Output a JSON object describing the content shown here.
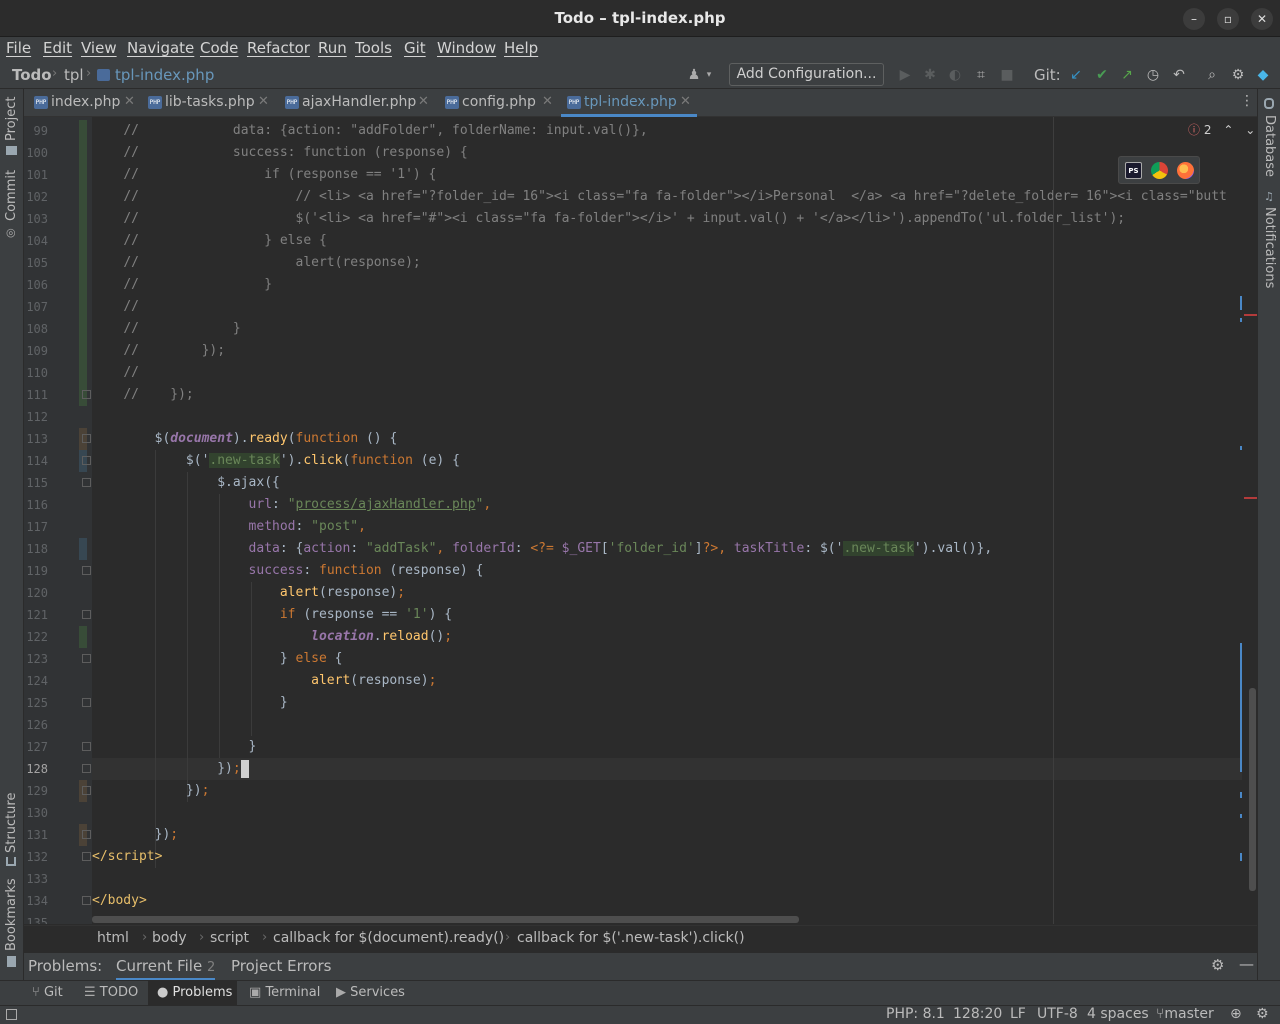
{
  "window": {
    "title": "Todo – tpl-index.php",
    "minimize_glyph": "–",
    "maximize_glyph": "▫",
    "close_glyph": "✕"
  },
  "menu": {
    "items": [
      "File",
      "Edit",
      "View",
      "Navigate",
      "Code",
      "Refactor",
      "Run",
      "Tools",
      "Git",
      "Window",
      "Help"
    ]
  },
  "nav": {
    "project": "Todo",
    "folder": "tpl",
    "file": "tpl-index.php",
    "add_configuration": "Add Configuration...",
    "git_label": "Git:"
  },
  "tabs": [
    {
      "label": "index.php",
      "active": false
    },
    {
      "label": "lib-tasks.php",
      "active": false
    },
    {
      "label": "ajaxHandler.php",
      "active": false
    },
    {
      "label": "config.php",
      "active": false
    },
    {
      "label": "tpl-index.php",
      "active": true
    }
  ],
  "tab_icon_text": "PHP",
  "side_tools": {
    "left_top": [
      "Project",
      "Commit"
    ],
    "left_bottom": [
      "Structure",
      "Bookmarks"
    ],
    "right": [
      "Database",
      "Notifications"
    ]
  },
  "editor": {
    "error_count": "2",
    "current_line": 128,
    "browser_icons": [
      "PS",
      "",
      ""
    ]
  },
  "code_lines": [
    {
      "n": "99"
    },
    {
      "n": "100"
    },
    {
      "n": "101"
    },
    {
      "n": "102"
    },
    {
      "n": "103"
    },
    {
      "n": "104"
    },
    {
      "n": "105"
    },
    {
      "n": "106"
    },
    {
      "n": "107"
    },
    {
      "n": "108"
    },
    {
      "n": "109"
    },
    {
      "n": "110"
    },
    {
      "n": "111"
    },
    {
      "n": "112"
    },
    {
      "n": "113"
    },
    {
      "n": "114"
    },
    {
      "n": "115"
    },
    {
      "n": "116"
    },
    {
      "n": "117"
    },
    {
      "n": "118"
    },
    {
      "n": "119"
    },
    {
      "n": "120"
    },
    {
      "n": "121"
    },
    {
      "n": "122"
    },
    {
      "n": "123"
    },
    {
      "n": "124"
    },
    {
      "n": "125"
    },
    {
      "n": "126"
    },
    {
      "n": "127"
    },
    {
      "n": "128"
    },
    {
      "n": "129"
    },
    {
      "n": "130"
    },
    {
      "n": "131"
    },
    {
      "n": "132"
    },
    {
      "n": "133"
    },
    {
      "n": "134"
    },
    {
      "n": "135"
    }
  ],
  "code": {
    "l99": [
      "//",
      "            data: {action: \"addFolder\", folderName: input.val()},"
    ],
    "l100": [
      "//",
      "            success: function (response) {"
    ],
    "l101": [
      "//",
      "                if (response == '1') {"
    ],
    "l102": [
      "//",
      "                    // <li> <a href=\"?folder_id= 16\"><i class=\"fa fa-folder\"></i>Personal  </a> <a href=\"?delete_folder= 16\"><i class=\"butt"
    ],
    "l103": [
      "//",
      "                    $('<li> <a href=\"#\"><i class=\"fa fa-folder\"></i>' + input.val() + '</a></li>').appendTo('ul.folder_list');"
    ],
    "l104": [
      "//",
      "                } else {"
    ],
    "l105": [
      "//",
      "                    alert(response);"
    ],
    "l106": [
      "//",
      "                }"
    ],
    "l107": [
      "//",
      ""
    ],
    "l108": [
      "//",
      "            }"
    ],
    "l109": [
      "//",
      "        });"
    ],
    "l110": [
      "//",
      ""
    ],
    "l111": [
      "//",
      "    });"
    ],
    "l113": {
      "a": "$(",
      "b": "document",
      "c": ").",
      "d": "ready",
      "e": "(",
      "f": "function",
      "g": " () {"
    },
    "l114": {
      "a": "$('",
      "b": ".new-task",
      "c": "').",
      "d": "click",
      "e": "(",
      "f": "function",
      "g": " (e) {"
    },
    "l115": {
      "a": "$.",
      "b": "ajax",
      "c": "({"
    },
    "l116": {
      "a": "url",
      "b": ": ",
      "c": "\"",
      "d": "process/ajaxHandler.php",
      "e": "\"",
      "f": ","
    },
    "l117": {
      "a": "method",
      "b": ": ",
      "c": "\"post\"",
      "d": ","
    },
    "l118": {
      "a": "data",
      "b": ": {",
      "c": "action",
      "d": ": ",
      "e": "\"addTask\"",
      "f": ", ",
      "g": "folderId",
      "h": ": ",
      "i": "<?=",
      "j": " $_GET",
      "k": "[",
      "l": "'folder_id'",
      "m": "]",
      "n": "?>",
      "o": ", ",
      "p": "taskTitle",
      "q": ": $('",
      "r": ".new-task",
      "s": "').val()},"
    },
    "l119": {
      "a": "success",
      "b": ": ",
      "c": "function",
      "d": " (response) {"
    },
    "l120": {
      "a": "alert",
      "b": "(response)",
      "c": ";"
    },
    "l121": {
      "a": "if",
      "b": " (response == ",
      "c": "'1'",
      "d": ") {"
    },
    "l122": {
      "a": "location",
      "b": ".",
      "c": "reload",
      "d": "()",
      "e": ";"
    },
    "l123": {
      "a": "} ",
      "b": "else",
      "c": " {"
    },
    "l124": {
      "a": "alert",
      "b": "(response)",
      "c": ";"
    },
    "l125": "}",
    "l127": "}",
    "l128": {
      "a": "})",
      "b": ";"
    },
    "l129": {
      "a": "})",
      "b": ";"
    },
    "l131": {
      "a": "})",
      "b": ";"
    },
    "l132": {
      "a": "</",
      "b": "script",
      "c": ">"
    },
    "l134": {
      "a": "</",
      "b": "body",
      "c": ">"
    },
    "l135": {
      "a": "</",
      "b": "html",
      "c": ">"
    }
  },
  "breadcrumb": [
    "html",
    "body",
    "script",
    "callback for $(document).ready()",
    "callback for $('.new-task').click()"
  ],
  "problems": {
    "label": "Problems:",
    "current_file": "Current File",
    "current_file_count": "2",
    "project_errors": "Project Errors"
  },
  "bottom_tools": [
    "Git",
    "TODO",
    "Problems",
    "Terminal",
    "Services"
  ],
  "status": {
    "php": "PHP: 8.1",
    "position": "128:20",
    "line_sep": "LF",
    "encoding": "UTF-8",
    "indent": "4 spaces",
    "branch": "master"
  },
  "colors": {
    "accent": "#4a88c7",
    "error": "#e06c6c",
    "git_update": "#3592c4",
    "git_commit": "#499c54",
    "git_push": "#57a64a"
  }
}
